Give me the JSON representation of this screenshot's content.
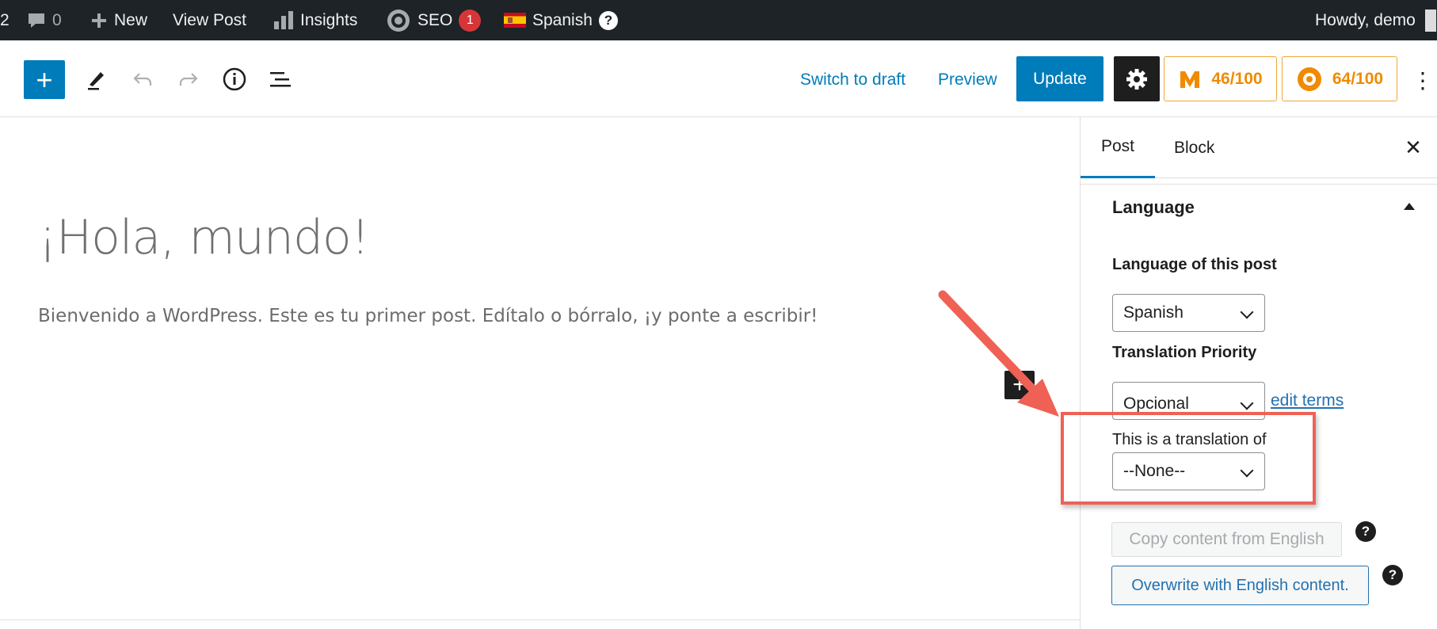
{
  "admin_bar": {
    "left_count": "2",
    "comments_count": "0",
    "new_label": "New",
    "view_post_label": "View Post",
    "insights_label": "Insights",
    "seo_label": "SEO",
    "seo_badge": "1",
    "language_label": "Spanish",
    "help_symbol": "?",
    "greeting": "Howdy, demo"
  },
  "header": {
    "inserter_symbol": "+",
    "switch_to_draft_label": "Switch to draft",
    "preview_label": "Preview",
    "update_label": "Update",
    "score_1": "46/100",
    "score_2": "64/100",
    "more_symbol": "⋮"
  },
  "content": {
    "title": "¡Hola, mundo!",
    "body": "Bienvenido a WordPress. Este es tu primer post. Edítalo o bórralo, ¡y ponte a escribir!",
    "block_inserter_symbol": "+"
  },
  "sidebar": {
    "tabs": [
      {
        "label": "Post",
        "active": true
      },
      {
        "label": "Block",
        "active": false
      }
    ],
    "close_symbol": "✕",
    "panel_title": "Language",
    "language_label": "Language of this post",
    "language_value": "Spanish",
    "priority_label": "Translation Priority",
    "priority_value": "Opcional",
    "edit_terms_label": "edit terms",
    "translation_of_label": "This is a translation of",
    "translation_of_value": "--None--",
    "copy_button_label": "Copy content from English",
    "overwrite_button_label": "Overwrite with English content.",
    "help_symbol": "?"
  },
  "colors": {
    "admin_bar_bg": "#1d2327",
    "primary": "#007cba",
    "score_orange": "#f08a00",
    "annotation_red": "#f06155"
  },
  "icons": {
    "comments": "comment-bubble-icon",
    "new": "plus-icon",
    "insights": "bar-chart-icon",
    "seo": "gear-icon",
    "flag": "spain-flag-icon",
    "edit": "pencil-icon",
    "undo": "undo-icon",
    "redo": "redo-icon",
    "info": "info-icon",
    "outline": "list-view-icon",
    "settings": "cog-icon"
  }
}
